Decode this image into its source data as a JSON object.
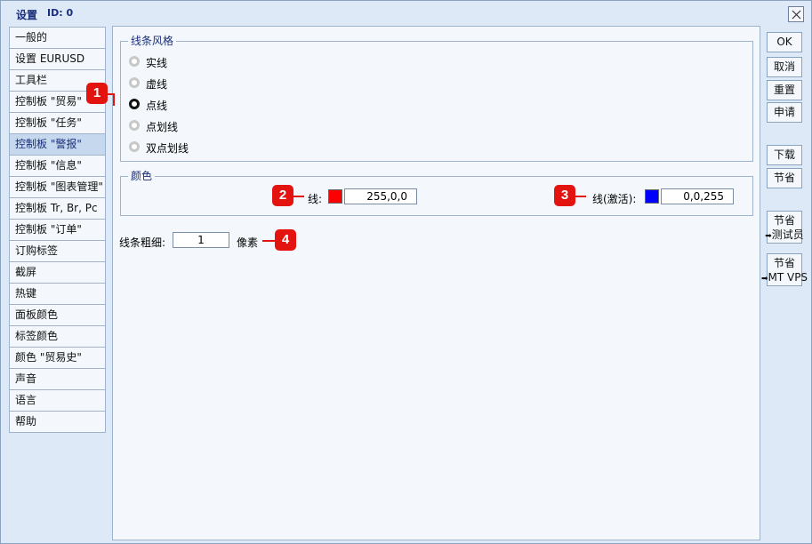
{
  "window": {
    "title": "设置",
    "id_label": "ID: 0"
  },
  "sidebar": {
    "items": [
      {
        "label": "一般的"
      },
      {
        "label": "设置 EURUSD"
      },
      {
        "label": "工具栏"
      },
      {
        "label": "控制板 \"贸易\""
      },
      {
        "label": "控制板 \"任务\""
      },
      {
        "label": "控制板 \"警报\"",
        "selected": true
      },
      {
        "label": "控制板 \"信息\""
      },
      {
        "label": "控制板 \"图表管理\""
      },
      {
        "label": "控制板 Tr, Br, Pc"
      },
      {
        "label": "控制板 \"订单\""
      },
      {
        "label": "订购标签"
      },
      {
        "label": "截屏"
      },
      {
        "label": "热键"
      },
      {
        "label": "面板颜色"
      },
      {
        "label": "标签颜色"
      },
      {
        "label": "颜色 \"贸易史\""
      },
      {
        "label": "声音"
      },
      {
        "label": "语言"
      },
      {
        "label": "帮助"
      }
    ]
  },
  "line_style": {
    "title": "线条风格",
    "options": [
      {
        "label": "实线",
        "checked": false
      },
      {
        "label": "虚线",
        "checked": false
      },
      {
        "label": "点线",
        "checked": true
      },
      {
        "label": "点划线",
        "checked": false
      },
      {
        "label": "双点划线",
        "checked": false
      }
    ]
  },
  "color": {
    "title": "颜色",
    "line_label": "线:",
    "line_color": "#ff0000",
    "line_value": "255,0,0",
    "active_label": "线(激活):",
    "active_color": "#0000ff",
    "active_value": "0,0,255"
  },
  "thickness": {
    "label": "线条粗细:",
    "value": "1",
    "unit": "像素"
  },
  "buttons": {
    "ok": "OK",
    "cancel": "取消",
    "reset": "重置",
    "apply": "申请",
    "download": "下载",
    "save": "节省",
    "save_tester_top": "节省",
    "save_tester_bottom": "测试员",
    "save_vps_top": "节省",
    "save_vps_bottom": "MT VPS"
  },
  "callouts": [
    "1",
    "2",
    "3",
    "4"
  ],
  "colors": {
    "accent": "#1a2e7a",
    "callout": "#e3130f",
    "window_bg": "#dde9f6",
    "panel_bg": "#f4f8fc"
  }
}
